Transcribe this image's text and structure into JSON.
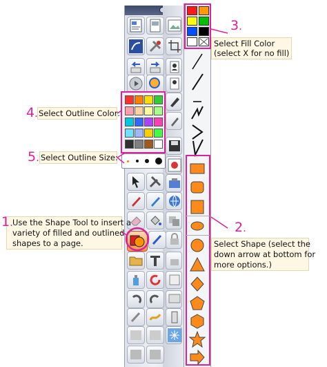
{
  "annotations": {
    "fill": {
      "number": "3",
      "line1": "Select Fill Color",
      "line2": "(select X for no fill)"
    },
    "shape": {
      "number": "2",
      "line1": "Select Shape (select the",
      "line2": "down arrow at bottom for",
      "line3": "more options.)"
    },
    "outline_color": {
      "number": "4",
      "text": "Select Outline Color:"
    },
    "outline_size": {
      "number": "5",
      "text": "Select Outline Size:"
    },
    "shape_tool": {
      "number": "1",
      "line1": "Use the Shape Tool to insert a",
      "line2": "variety of filled and outlined",
      "line3": "shapes to a page."
    }
  },
  "fill_colors": [
    "#ff1a1a",
    "#ff9a00",
    "#ffff00",
    "#00c000",
    "#0050ff",
    "#000000",
    "#ffffff",
    "none"
  ],
  "outline_colors": [
    "#ff3030",
    "#ff7f00",
    "#ffdd00",
    "#33cc33",
    "#ff9fb0",
    "#ffd0a0",
    "#ffffa0",
    "#a8ff88",
    "#00c8e0",
    "#3366ff",
    "#b040ff",
    "#ff40b0",
    "#70e0ff",
    "#a0b8ff",
    "#ffd000",
    "#40ff40",
    "#303030",
    "#808080",
    "#a05a20",
    "#ffffff"
  ],
  "shapes": [
    "rectangle",
    "rounded-rectangle",
    "square",
    "ellipse",
    "circle",
    "triangle",
    "diamond",
    "pentagon",
    "hexagon",
    "star",
    "right-arrow"
  ],
  "line_tools": [
    "line",
    "diagonal-line",
    "horizontal-line",
    "zigzag-line",
    "curved-arrow-line",
    "check-line"
  ],
  "accent_color": "#e0209a"
}
